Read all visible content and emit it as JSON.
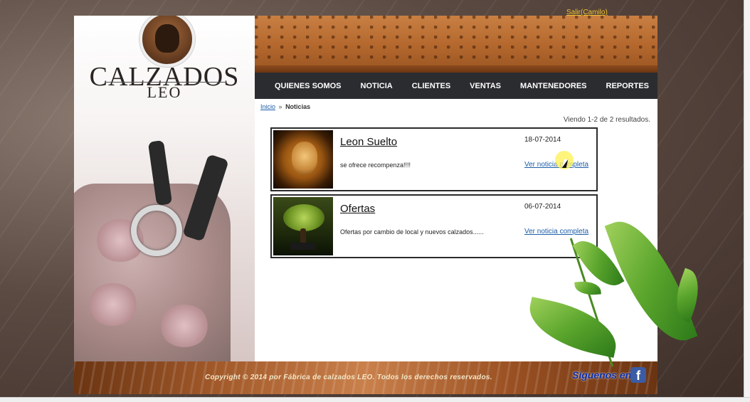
{
  "header": {
    "logout_link": "Salir(Camilo)",
    "logo_title": "CALZADOS",
    "logo_subtitle": "LEO"
  },
  "nav": {
    "items": [
      {
        "label": "QUIENES SOMOS"
      },
      {
        "label": "NOTICIA"
      },
      {
        "label": "CLIENTES"
      },
      {
        "label": "VENTAS"
      },
      {
        "label": "MANTENEDORES"
      },
      {
        "label": "REPORTES"
      }
    ]
  },
  "breadcrumb": {
    "home": "Inicio",
    "separator": "»",
    "current": "Noticias"
  },
  "results_summary": "Viendo 1-2 de 2 resultados.",
  "news": [
    {
      "title": "Leon Suelto",
      "date": "18-07-2014",
      "summary": "se ofrece recompenza!!!!",
      "link": "Ver noticia completa",
      "image_icon": "lion-photo"
    },
    {
      "title": "Ofertas",
      "date": "06-07-2014",
      "summary": "Ofertas por cambio de local y nuevos calzados......",
      "link": "Ver noticia completa",
      "image_icon": "bonsai-photo"
    }
  ],
  "footer": {
    "copyright": "Copyright © 2014 por Fábrica de calzados LEO. Todos los derechos reservados.",
    "follow_label": "Síguenos en:",
    "facebook_icon": "f"
  },
  "colors": {
    "nav_bg": "#2b2c30",
    "link_blue": "#1d5ea8",
    "logout_yellow": "#f1c232",
    "follow_blue": "#0c2ea8"
  }
}
